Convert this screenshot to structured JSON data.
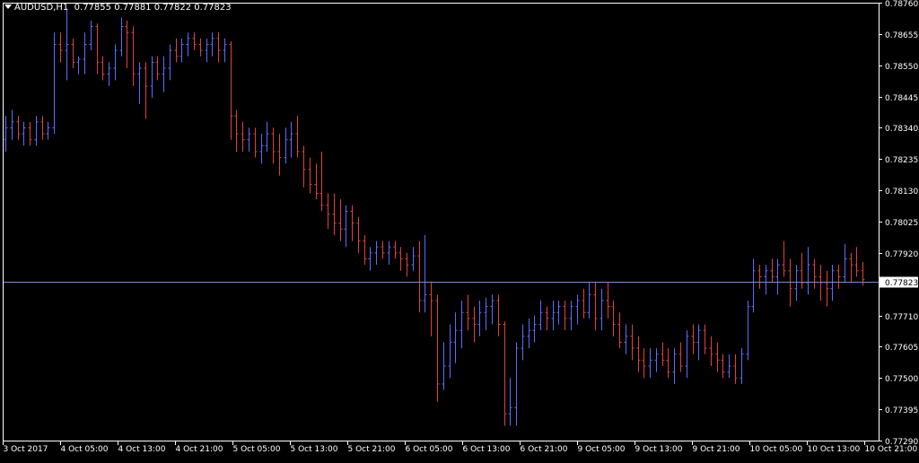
{
  "header": {
    "symbol": "AUDUSD,H1",
    "ohlc": "0.77855 0.77881 0.77822 0.77823"
  },
  "colors": {
    "background": "#000000",
    "frame": "#ffffff",
    "bull": "#5a6cff",
    "bear": "#e0413a",
    "current_line": "#7c8cd0",
    "label_bg": "#ffffff",
    "label_text": "#000000",
    "text": "#ffffff"
  },
  "chart_data": {
    "type": "bar",
    "title": "AUDUSD,H1",
    "ylim": [
      0.7729,
      0.7876
    ],
    "y_ticks": [
      "0.78760",
      "0.78655",
      "0.78550",
      "0.78445",
      "0.78340",
      "0.78235",
      "0.78130",
      "0.78025",
      "0.77920",
      "0.77710",
      "0.77605",
      "0.77500",
      "0.77395",
      "0.77290"
    ],
    "current_price": "0.77823",
    "x_ticks": [
      "3 Oct 2017",
      "4 Oct 05:00",
      "4 Oct 13:00",
      "4 Oct 21:00",
      "5 Oct 05:00",
      "5 Oct 13:00",
      "5 Oct 21:00",
      "6 Oct 05:00",
      "6 Oct 13:00",
      "6 Oct 21:00",
      "9 Oct 05:00",
      "9 Oct 13:00",
      "9 Oct 21:00",
      "10 Oct 05:00",
      "10 Oct 13:00",
      "10 Oct 21:00"
    ],
    "grid": false,
    "series": [
      {
        "ohlc": [
          [
            0.783,
            0.7838,
            0.7826,
            0.7834
          ],
          [
            0.7834,
            0.784,
            0.783,
            0.7836
          ],
          [
            0.7836,
            0.7838,
            0.783,
            0.7832
          ],
          [
            0.7832,
            0.7836,
            0.7828,
            0.7834
          ],
          [
            0.7834,
            0.7836,
            0.7828,
            0.783
          ],
          [
            0.783,
            0.7838,
            0.7828,
            0.7836
          ],
          [
            0.7836,
            0.7838,
            0.783,
            0.7832
          ],
          [
            0.7832,
            0.7836,
            0.783,
            0.7834
          ],
          [
            0.7834,
            0.7866,
            0.7832,
            0.7862
          ],
          [
            0.7862,
            0.7866,
            0.7856,
            0.786
          ],
          [
            0.786,
            0.7874,
            0.785,
            0.7862
          ],
          [
            0.7862,
            0.7864,
            0.7854,
            0.7856
          ],
          [
            0.7856,
            0.7858,
            0.7852,
            0.7857
          ],
          [
            0.7857,
            0.7866,
            0.7852,
            0.7862
          ],
          [
            0.7862,
            0.787,
            0.786,
            0.7868
          ],
          [
            0.7868,
            0.7869,
            0.7852,
            0.7856
          ],
          [
            0.7856,
            0.7858,
            0.785,
            0.7852
          ],
          [
            0.7852,
            0.7856,
            0.7848,
            0.7854
          ],
          [
            0.7854,
            0.7862,
            0.785,
            0.786
          ],
          [
            0.786,
            0.7871,
            0.7858,
            0.7868
          ],
          [
            0.7868,
            0.787,
            0.7854,
            0.7866
          ],
          [
            0.7866,
            0.7868,
            0.7848,
            0.7852
          ],
          [
            0.7852,
            0.7856,
            0.7842,
            0.7854
          ],
          [
            0.7854,
            0.7856,
            0.7837,
            0.7848
          ],
          [
            0.7848,
            0.7858,
            0.7844,
            0.7856
          ],
          [
            0.7856,
            0.7858,
            0.785,
            0.7852
          ],
          [
            0.7852,
            0.7858,
            0.7846,
            0.7854
          ],
          [
            0.7854,
            0.7862,
            0.785,
            0.786
          ],
          [
            0.786,
            0.7864,
            0.7856,
            0.7858
          ],
          [
            0.7858,
            0.7864,
            0.7856,
            0.7862
          ],
          [
            0.7862,
            0.7866,
            0.7858,
            0.7864
          ],
          [
            0.7864,
            0.7866,
            0.786,
            0.7862
          ],
          [
            0.7862,
            0.7864,
            0.7858,
            0.786
          ],
          [
            0.786,
            0.7864,
            0.7856,
            0.7862
          ],
          [
            0.7862,
            0.7866,
            0.7858,
            0.7864
          ],
          [
            0.7864,
            0.7866,
            0.7856,
            0.786
          ],
          [
            0.786,
            0.7864,
            0.7856,
            0.7862
          ],
          [
            0.7862,
            0.7863,
            0.783,
            0.7838
          ],
          [
            0.7838,
            0.784,
            0.7826,
            0.7832
          ],
          [
            0.7832,
            0.7836,
            0.7826,
            0.783
          ],
          [
            0.783,
            0.7834,
            0.7826,
            0.7832
          ],
          [
            0.7832,
            0.7834,
            0.7824,
            0.7826
          ],
          [
            0.7826,
            0.7832,
            0.7822,
            0.7828
          ],
          [
            0.7828,
            0.7836,
            0.7826,
            0.7832
          ],
          [
            0.7832,
            0.7834,
            0.7822,
            0.7826
          ],
          [
            0.7826,
            0.7832,
            0.7818,
            0.7824
          ],
          [
            0.7824,
            0.7834,
            0.7822,
            0.783
          ],
          [
            0.783,
            0.7836,
            0.7824,
            0.7832
          ],
          [
            0.7832,
            0.7838,
            0.7824,
            0.7826
          ],
          [
            0.7826,
            0.7828,
            0.7814,
            0.782
          ],
          [
            0.782,
            0.7824,
            0.7812,
            0.7815
          ],
          [
            0.7815,
            0.7822,
            0.781,
            0.7812
          ],
          [
            0.7812,
            0.7826,
            0.7806,
            0.7808
          ],
          [
            0.7808,
            0.7812,
            0.78,
            0.7805
          ],
          [
            0.7805,
            0.7812,
            0.7798,
            0.7802
          ],
          [
            0.7802,
            0.781,
            0.7796,
            0.78
          ],
          [
            0.78,
            0.7808,
            0.7794,
            0.7806
          ],
          [
            0.7806,
            0.7808,
            0.7796,
            0.7802
          ],
          [
            0.7802,
            0.7804,
            0.7792,
            0.7796
          ],
          [
            0.7796,
            0.7798,
            0.7788,
            0.779
          ],
          [
            0.779,
            0.7794,
            0.7786,
            0.7792
          ],
          [
            0.7792,
            0.7796,
            0.7788,
            0.7794
          ],
          [
            0.7794,
            0.7796,
            0.779,
            0.7792
          ],
          [
            0.7792,
            0.7796,
            0.7788,
            0.7794
          ],
          [
            0.7794,
            0.7796,
            0.779,
            0.7792
          ],
          [
            0.7792,
            0.7794,
            0.7786,
            0.779
          ],
          [
            0.779,
            0.7792,
            0.7784,
            0.7788
          ],
          [
            0.7788,
            0.7794,
            0.7786,
            0.7791
          ],
          [
            0.7791,
            0.7796,
            0.7772,
            0.7776
          ],
          [
            0.7776,
            0.7798,
            0.7772,
            0.7778
          ],
          [
            0.7778,
            0.7782,
            0.7764,
            0.7776
          ],
          [
            0.7776,
            0.7778,
            0.7742,
            0.7748
          ],
          [
            0.7748,
            0.7762,
            0.7746,
            0.7754
          ],
          [
            0.7754,
            0.7768,
            0.775,
            0.7762
          ],
          [
            0.7762,
            0.7772,
            0.7755,
            0.7766
          ],
          [
            0.7766,
            0.7776,
            0.776,
            0.7772
          ],
          [
            0.7772,
            0.7778,
            0.7766,
            0.777
          ],
          [
            0.777,
            0.7774,
            0.7762,
            0.7768
          ],
          [
            0.7768,
            0.7776,
            0.7764,
            0.7772
          ],
          [
            0.7772,
            0.7777,
            0.7766,
            0.7774
          ],
          [
            0.7774,
            0.7778,
            0.7768,
            0.7776
          ],
          [
            0.7776,
            0.7778,
            0.7764,
            0.7768
          ],
          [
            0.7768,
            0.7769,
            0.7734,
            0.7738
          ],
          [
            0.7738,
            0.775,
            0.7734,
            0.774
          ],
          [
            0.774,
            0.7762,
            0.7734,
            0.776
          ],
          [
            0.776,
            0.7768,
            0.7756,
            0.7764
          ],
          [
            0.7764,
            0.777,
            0.776,
            0.7766
          ],
          [
            0.7766,
            0.7771,
            0.7762,
            0.7768
          ],
          [
            0.7768,
            0.7776,
            0.7766,
            0.7772
          ],
          [
            0.7772,
            0.7774,
            0.7766,
            0.777
          ],
          [
            0.777,
            0.7776,
            0.7766,
            0.7772
          ],
          [
            0.7772,
            0.7776,
            0.7768,
            0.7774
          ],
          [
            0.7774,
            0.7776,
            0.7766,
            0.777
          ],
          [
            0.777,
            0.7776,
            0.7766,
            0.7774
          ],
          [
            0.7774,
            0.7778,
            0.7768,
            0.7776
          ],
          [
            0.7776,
            0.778,
            0.777,
            0.7772
          ],
          [
            0.7772,
            0.7782,
            0.777,
            0.7778
          ],
          [
            0.7778,
            0.7782,
            0.7766,
            0.777
          ],
          [
            0.777,
            0.778,
            0.7766,
            0.7776
          ],
          [
            0.7776,
            0.7782,
            0.777,
            0.7774
          ],
          [
            0.7774,
            0.7776,
            0.7764,
            0.7768
          ],
          [
            0.7768,
            0.7772,
            0.776,
            0.7762
          ],
          [
            0.7762,
            0.7768,
            0.7758,
            0.7764
          ],
          [
            0.7764,
            0.7768,
            0.7756,
            0.776
          ],
          [
            0.776,
            0.7764,
            0.7752,
            0.7756
          ],
          [
            0.7756,
            0.776,
            0.775,
            0.7754
          ],
          [
            0.7754,
            0.776,
            0.775,
            0.7756
          ],
          [
            0.7756,
            0.776,
            0.7752,
            0.7758
          ],
          [
            0.7758,
            0.7762,
            0.7754,
            0.7756
          ],
          [
            0.7756,
            0.776,
            0.775,
            0.7752
          ],
          [
            0.7752,
            0.776,
            0.7748,
            0.7758
          ],
          [
            0.7758,
            0.7762,
            0.7752,
            0.7754
          ],
          [
            0.7754,
            0.7766,
            0.775,
            0.7764
          ],
          [
            0.7764,
            0.7768,
            0.7758,
            0.7762
          ],
          [
            0.7762,
            0.7768,
            0.7756,
            0.7766
          ],
          [
            0.7766,
            0.7768,
            0.7758,
            0.776
          ],
          [
            0.776,
            0.7764,
            0.7754,
            0.7758
          ],
          [
            0.7758,
            0.7762,
            0.7752,
            0.7756
          ],
          [
            0.7756,
            0.7758,
            0.775,
            0.7752
          ],
          [
            0.7752,
            0.7758,
            0.775,
            0.7754
          ],
          [
            0.7754,
            0.7758,
            0.7748,
            0.775
          ],
          [
            0.775,
            0.776,
            0.7748,
            0.7758
          ],
          [
            0.7758,
            0.7776,
            0.7756,
            0.7774
          ],
          [
            0.7774,
            0.779,
            0.7772,
            0.7786
          ],
          [
            0.7786,
            0.7788,
            0.778,
            0.7784
          ],
          [
            0.7784,
            0.7788,
            0.7778,
            0.7786
          ],
          [
            0.7786,
            0.779,
            0.7782,
            0.7784
          ],
          [
            0.7784,
            0.779,
            0.7778,
            0.7788
          ],
          [
            0.7788,
            0.7796,
            0.7784,
            0.7786
          ],
          [
            0.7786,
            0.779,
            0.7774,
            0.778
          ],
          [
            0.778,
            0.7788,
            0.7776,
            0.7786
          ],
          [
            0.7786,
            0.7792,
            0.778,
            0.7782
          ],
          [
            0.7782,
            0.7794,
            0.7778,
            0.7788
          ],
          [
            0.7788,
            0.779,
            0.778,
            0.7784
          ],
          [
            0.7784,
            0.7788,
            0.7776,
            0.7782
          ],
          [
            0.7782,
            0.7786,
            0.7774,
            0.778
          ],
          [
            0.778,
            0.7788,
            0.7776,
            0.7786
          ],
          [
            0.7786,
            0.7788,
            0.778,
            0.7784
          ],
          [
            0.7784,
            0.7795,
            0.7782,
            0.779
          ],
          [
            0.779,
            0.7792,
            0.7782,
            0.7788
          ],
          [
            0.7788,
            0.7794,
            0.7784,
            0.7786
          ],
          [
            0.7786,
            0.7789,
            0.7781,
            0.7783
          ]
        ]
      }
    ]
  }
}
